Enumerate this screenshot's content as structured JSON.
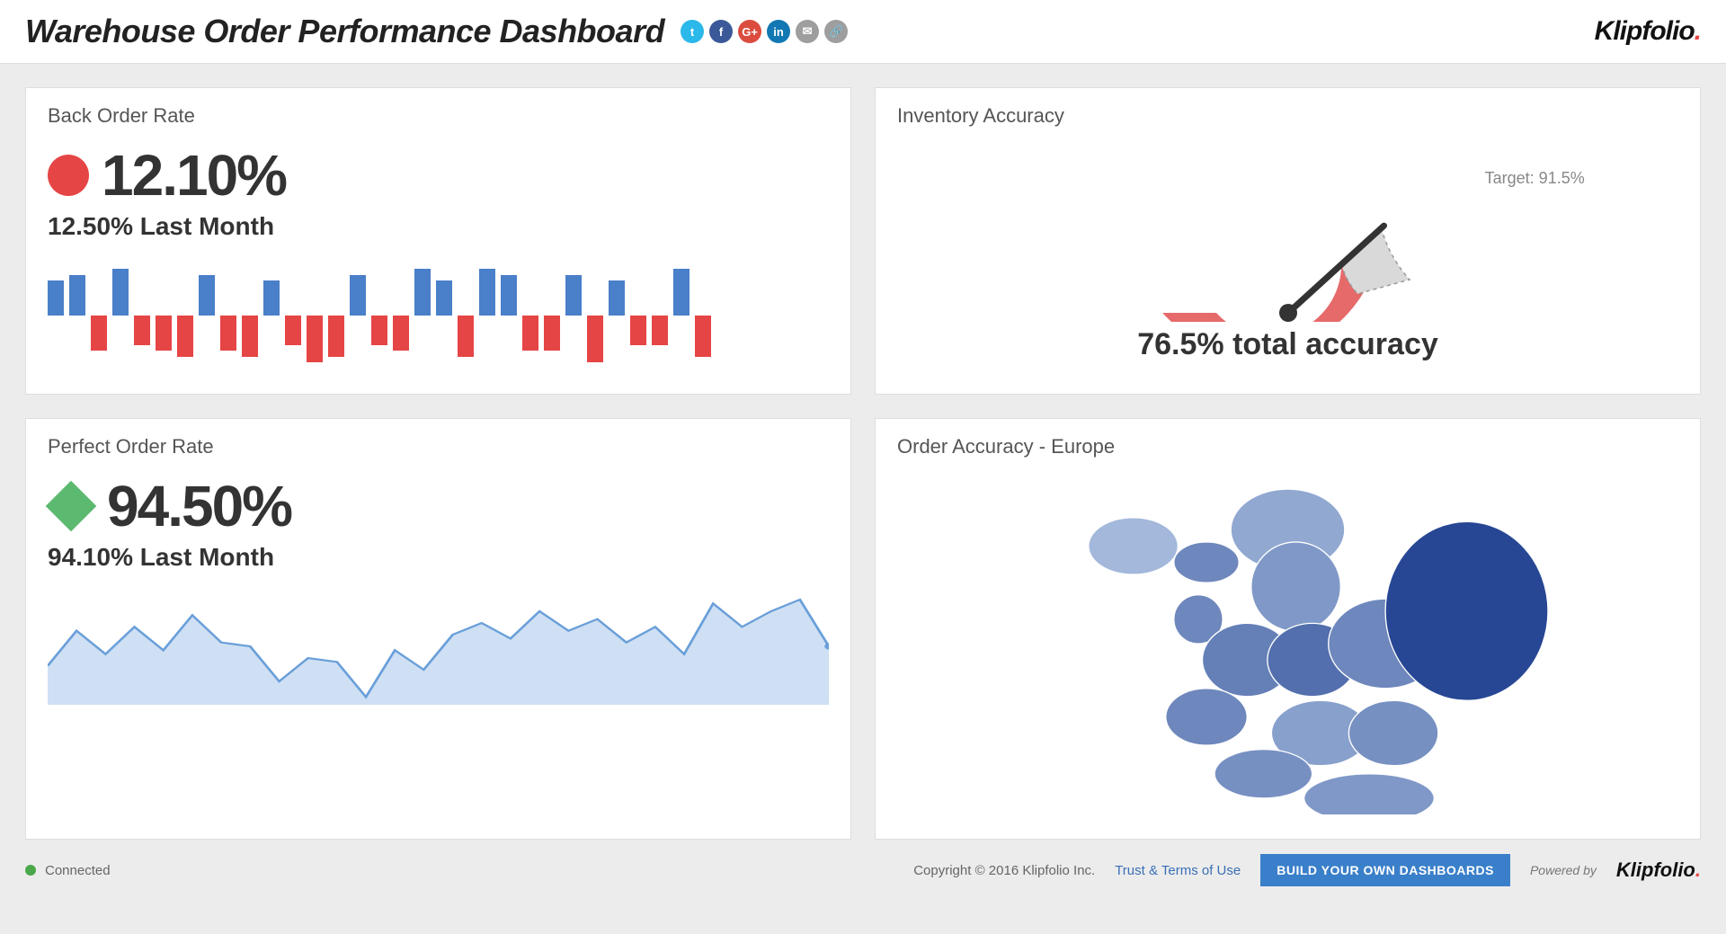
{
  "header": {
    "title": "Warehouse Order Performance Dashboard",
    "logo": "Klipfolio",
    "share_icons": [
      {
        "name": "twitter",
        "glyph": "t",
        "bg": "#2bb8ea"
      },
      {
        "name": "facebook",
        "glyph": "f",
        "bg": "#3b5998"
      },
      {
        "name": "gplus",
        "glyph": "G+",
        "bg": "#db4c3f"
      },
      {
        "name": "linkedin",
        "glyph": "in",
        "bg": "#1178b3"
      },
      {
        "name": "email",
        "glyph": "✉",
        "bg": "#9e9e9e"
      },
      {
        "name": "link",
        "glyph": "🔗",
        "bg": "#9e9e9e"
      }
    ]
  },
  "back_order": {
    "title": "Back Order Rate",
    "value": "12.10%",
    "previous": "12.50% Last Month"
  },
  "perfect_order": {
    "title": "Perfect Order Rate",
    "value": "94.50%",
    "previous": "94.10% Last Month"
  },
  "inventory_accuracy": {
    "title": "Inventory Accuracy",
    "target_label": "Target: 91.5%",
    "summary": "76.5% total accuracy"
  },
  "order_accuracy_map": {
    "title": "Order Accuracy - Europe"
  },
  "footer": {
    "status": "Connected",
    "copyright": "Copyright © 2016 Klipfolio Inc.",
    "terms": "Trust & Terms of Use",
    "cta": "BUILD YOUR OWN DASHBOARDS",
    "powered_by": "Powered by",
    "logo": "Klipfolio"
  },
  "chart_data": [
    {
      "type": "bar",
      "name": "back_order_updown",
      "title": "Back Order Rate — daily deviation (blue=up, red=down)",
      "values": [
        0.6,
        0.7,
        -0.6,
        0.8,
        -0.5,
        -0.6,
        -0.7,
        0.7,
        -0.6,
        -0.7,
        0.6,
        -0.5,
        -0.8,
        -0.7,
        0.7,
        -0.5,
        -0.6,
        0.8,
        0.6,
        -0.7,
        0.8,
        0.7,
        -0.6,
        -0.6,
        0.7,
        -0.8,
        0.6,
        -0.5,
        -0.5,
        0.8,
        -0.7
      ],
      "ylim": [
        -1,
        1
      ],
      "colors": {
        "positive": "#4a7fc9",
        "negative": "#e64545"
      }
    },
    {
      "type": "area",
      "name": "perfect_order_trend",
      "title": "Perfect Order Rate trend",
      "values": [
        92.0,
        93.8,
        92.6,
        94.0,
        92.8,
        94.6,
        93.2,
        93.0,
        91.2,
        92.4,
        92.2,
        90.4,
        92.8,
        91.8,
        93.6,
        94.2,
        93.4,
        94.8,
        93.8,
        94.4,
        93.2,
        94.0,
        92.6,
        95.2,
        94.0,
        94.8,
        95.4,
        93.0
      ],
      "ylim": [
        90,
        96
      ],
      "color": "#6a9fd9",
      "fill": "#cfe0f4"
    },
    {
      "type": "gauge",
      "name": "inventory_accuracy_gauge",
      "value": 76.5,
      "target": 91.5,
      "range": [
        0,
        100
      ],
      "arc_deg": [
        180,
        0
      ],
      "fill": "#e66a6a",
      "bg": "#d9d9d9"
    },
    {
      "type": "choropleth",
      "name": "order_accuracy_europe",
      "region": "Europe",
      "scale": [
        "#cfe0f4",
        "#1e3f8f"
      ],
      "note": "Country-level values not legible in source image"
    }
  ]
}
